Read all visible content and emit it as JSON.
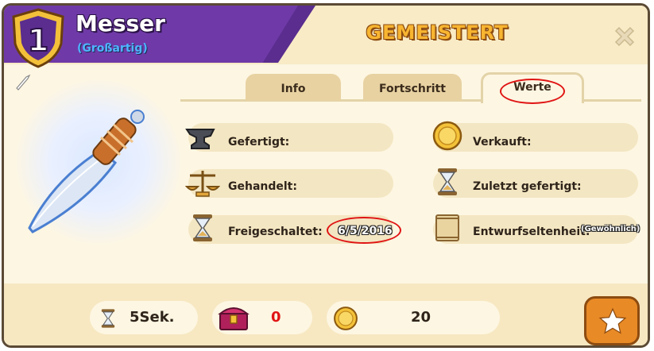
{
  "header": {
    "level": "1",
    "title": "Messer",
    "quality": "(Großartig)",
    "status": "GEMEISTERT"
  },
  "tabs": [
    {
      "label": "Info",
      "active": false
    },
    {
      "label": "Fortschritt",
      "active": false
    },
    {
      "label": "Werte",
      "active": true
    }
  ],
  "stats": {
    "crafted_label": "Gefertigt:",
    "sold_label": "Verkauft:",
    "traded_label": "Gehandelt:",
    "last_crafted_label": "Zuletzt gefertigt:",
    "unlocked_label": "Freigeschaltet:",
    "unlocked_value": "6/5/2016",
    "rarity_label": "Entwurfseltenheit:",
    "rarity_value": "(Gewöhnlich)"
  },
  "footer": {
    "time": "5Sek.",
    "chest_count": "0",
    "coins": "20"
  },
  "icons": {
    "close": "close-icon",
    "favorite": "star-icon",
    "item": "knife-icon"
  },
  "colors": {
    "header_purple": "#6f3aa8",
    "status_gold": "#f7b531",
    "subtitle_blue": "#4fb4ff",
    "highlight_red": "#e01414",
    "chest_value_red": "#e01414"
  }
}
